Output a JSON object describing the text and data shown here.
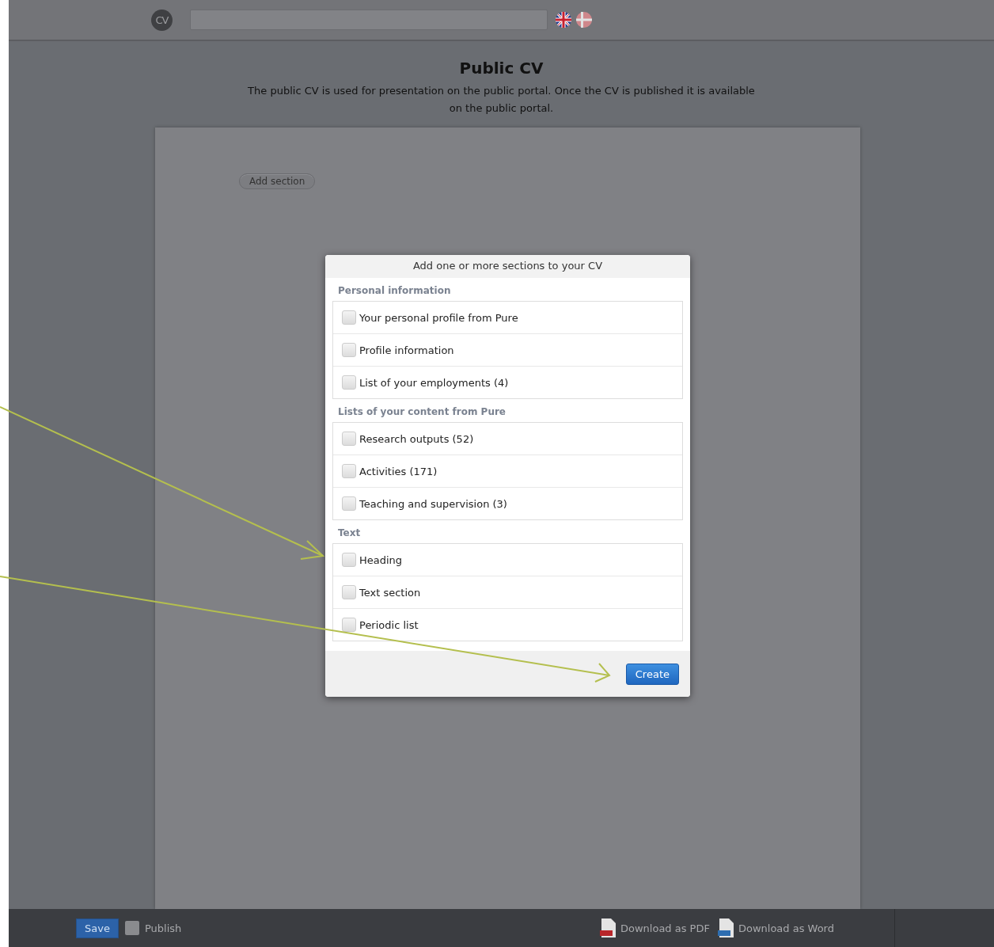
{
  "header": {
    "logo": "CV"
  },
  "page": {
    "title": "Public CV",
    "description": "The public CV is used for presentation on the public portal. Once the CV is published it is available on the public portal.",
    "add_section": "Add section"
  },
  "dialog": {
    "title": "Add one or more sections to your CV",
    "groups": [
      {
        "label": "Personal information",
        "items": [
          {
            "label": "Your personal profile from Pure",
            "checked": false
          },
          {
            "label": "Profile information",
            "checked": false
          },
          {
            "label": "List of your employments (4)",
            "checked": false
          }
        ]
      },
      {
        "label": "Lists of your content from Pure",
        "items": [
          {
            "label": "Research outputs (52)",
            "checked": false
          },
          {
            "label": "Activities (171)",
            "checked": false
          },
          {
            "label": "Teaching and supervision (3)",
            "checked": false
          }
        ]
      },
      {
        "label": "Text",
        "items": [
          {
            "label": "Heading",
            "checked": false
          },
          {
            "label": "Text section",
            "checked": false
          },
          {
            "label": "Periodic list",
            "checked": false
          }
        ]
      }
    ],
    "create": "Create"
  },
  "footer": {
    "save": "Save",
    "publish": {
      "label": "Publish",
      "checked": false
    },
    "downloads": [
      {
        "kind": "pdf",
        "label": "Download as PDF"
      },
      {
        "kind": "word",
        "label": "Download as Word"
      }
    ]
  }
}
